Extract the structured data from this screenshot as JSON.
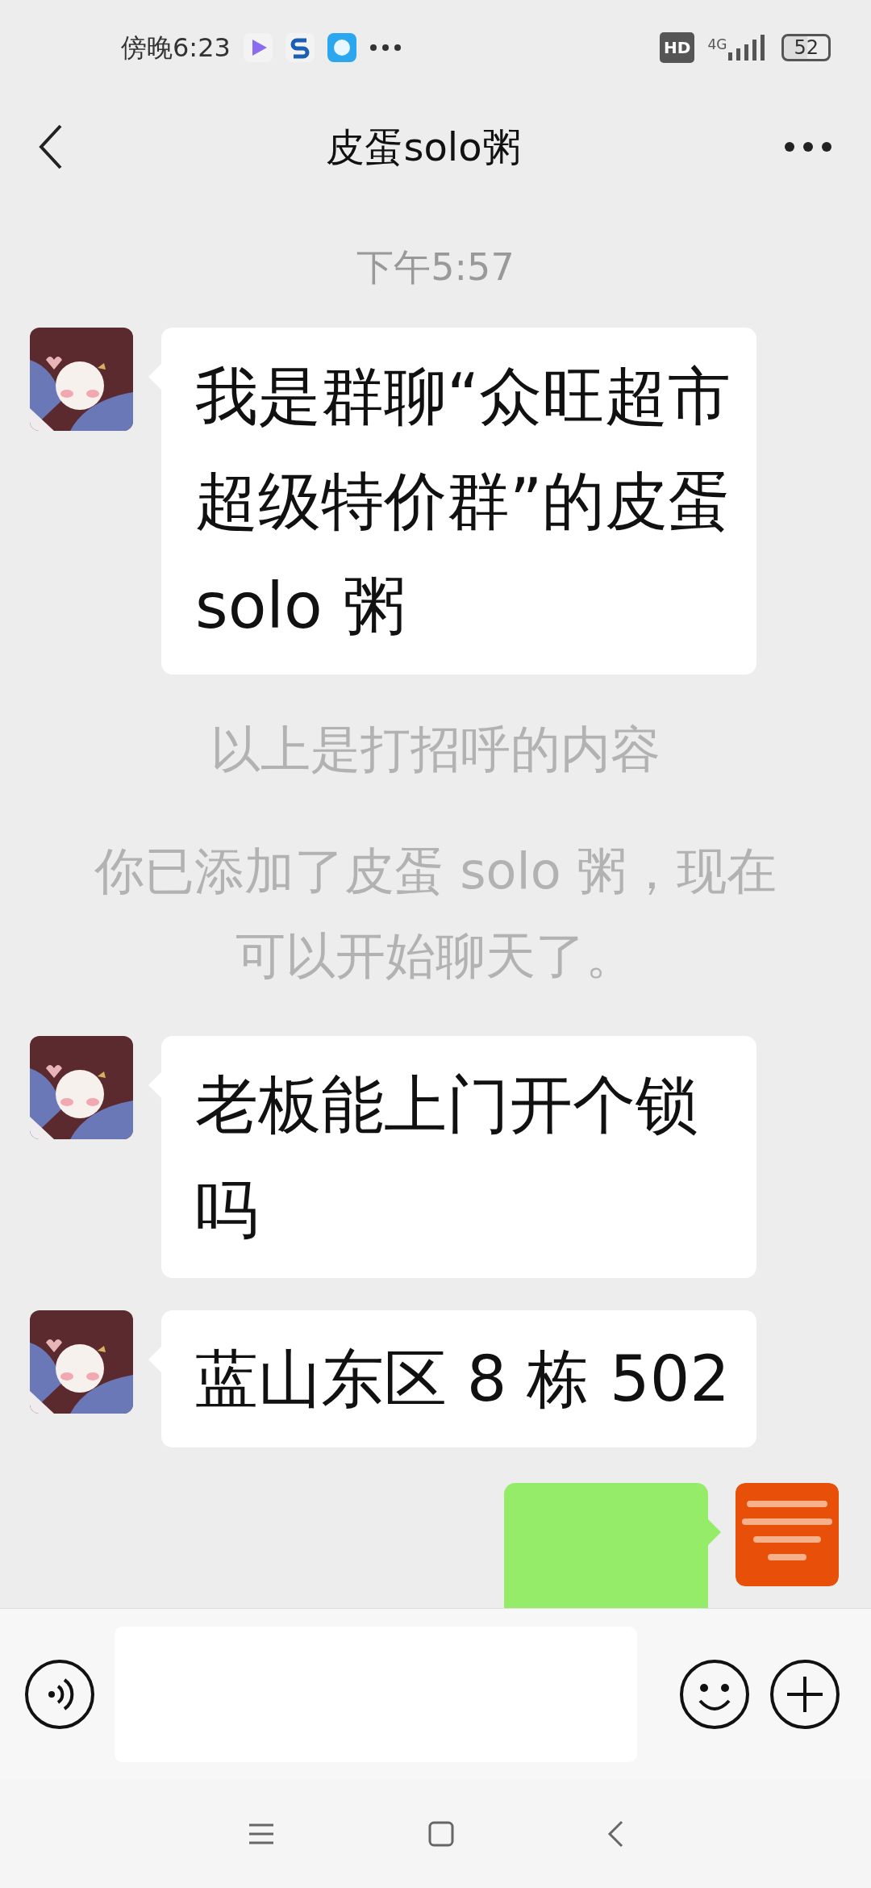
{
  "status_bar": {
    "time": "傍晚6:23",
    "hd": "HD",
    "network": "4G",
    "battery": "52"
  },
  "header": {
    "title": "皮蛋solo粥"
  },
  "messages": [
    {
      "kind": "time",
      "text": "下午5:57"
    },
    {
      "kind": "received",
      "text": "我是群聊“众旺超市超级特价群”的皮蛋 solo 粥"
    },
    {
      "kind": "system",
      "text": "以上是打招呼的内容"
    },
    {
      "kind": "system",
      "text": "你已添加了皮蛋 solo 粥，现在可以开始聊天了。"
    },
    {
      "kind": "received",
      "text": "老板能上门开个锁吗"
    },
    {
      "kind": "received",
      "text": "蓝山东区 8 栋 502"
    },
    {
      "kind": "sent"
    }
  ]
}
